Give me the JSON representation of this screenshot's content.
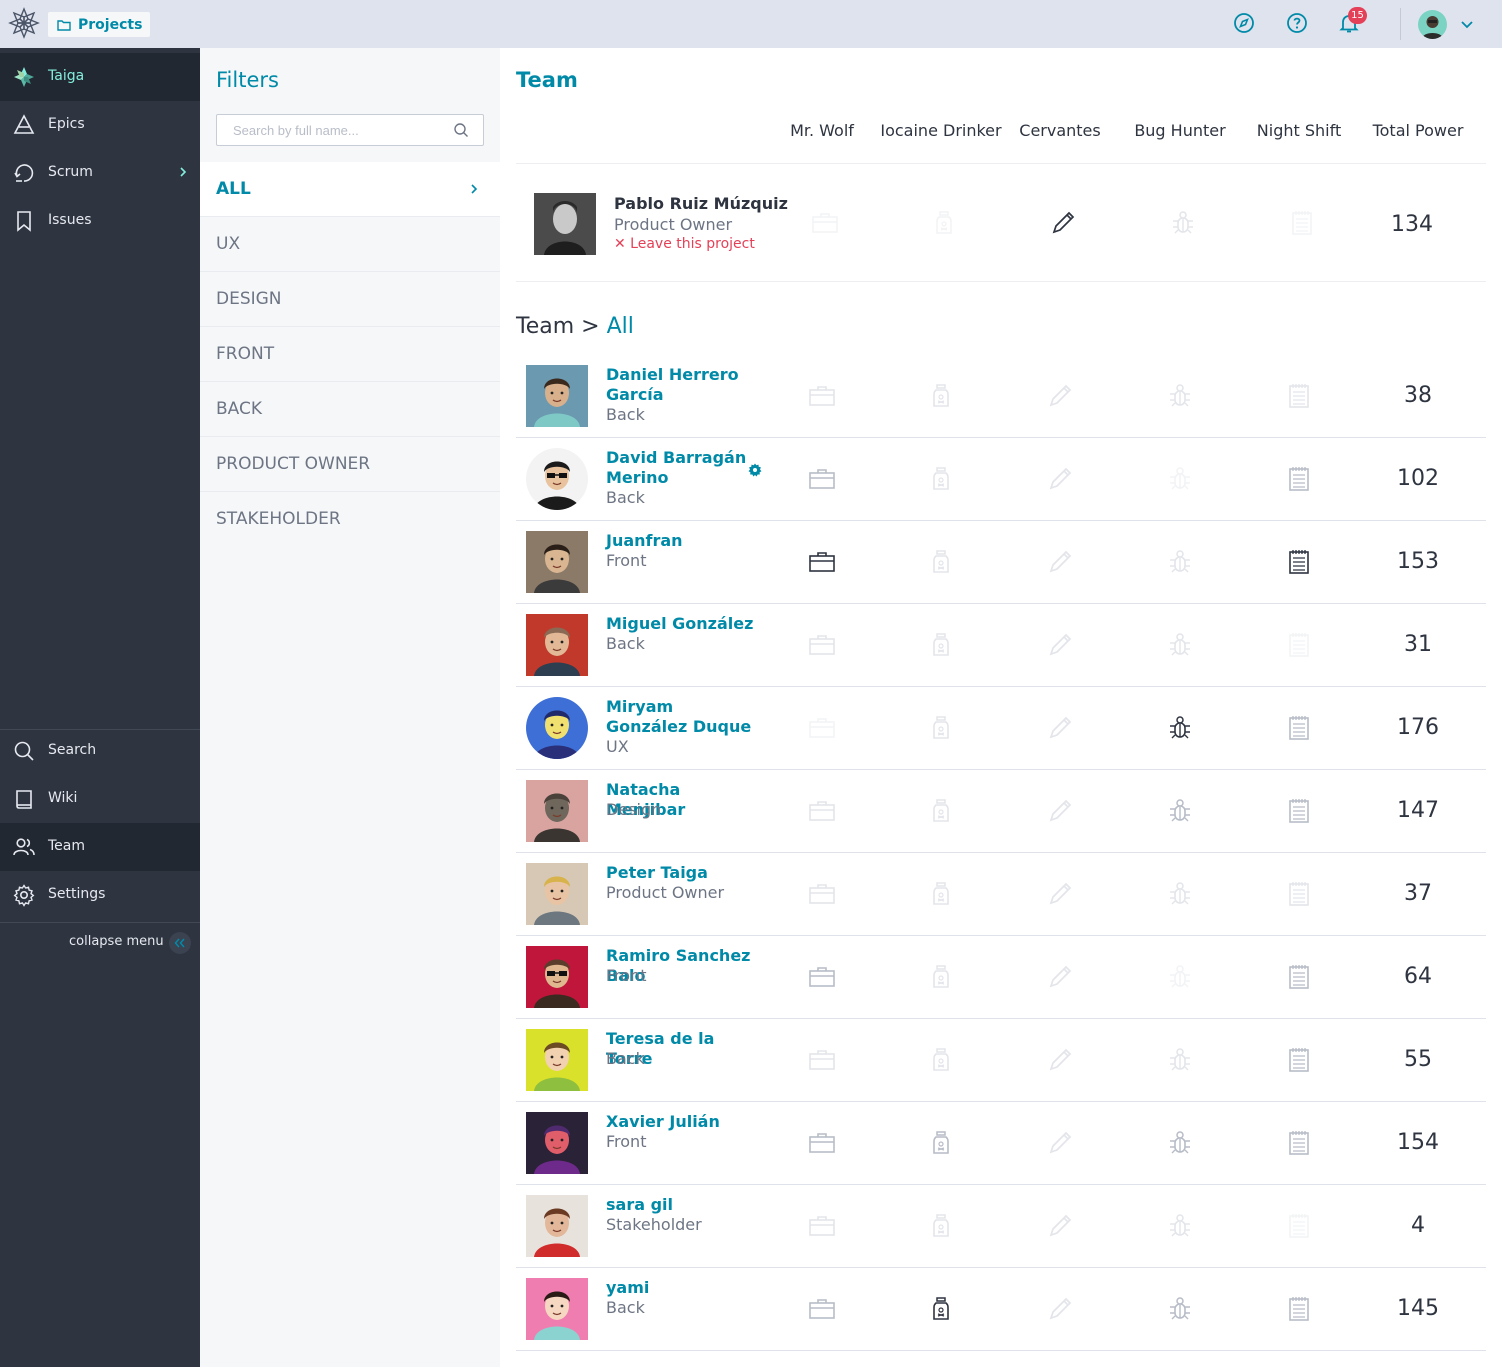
{
  "topbar": {
    "projects_label": "Projects",
    "notifications_count": "15"
  },
  "sidebar": {
    "items": [
      {
        "label": "Taiga",
        "icon": "taiga-logo-icon"
      },
      {
        "label": "Epics",
        "icon": "epics-icon"
      },
      {
        "label": "Scrum",
        "icon": "scrum-icon"
      },
      {
        "label": "Issues",
        "icon": "bookmark-icon"
      },
      {
        "label": "Search",
        "icon": "search-icon"
      },
      {
        "label": "Wiki",
        "icon": "book-icon"
      },
      {
        "label": "Team",
        "icon": "team-icon"
      },
      {
        "label": "Settings",
        "icon": "gear-icon"
      }
    ],
    "collapse_label": "collapse menu"
  },
  "filters": {
    "title": "Filters",
    "search_placeholder": "Search by full name...",
    "roles": [
      "ALL",
      "UX",
      "DESIGN",
      "FRONT",
      "BACK",
      "PRODUCT OWNER",
      "STAKEHOLDER"
    ],
    "active_role": "ALL"
  },
  "main": {
    "title": "Team",
    "columns": [
      "Mr. Wolf",
      "Iocaine Drinker",
      "Cervantes",
      "Bug Hunter",
      "Night Shift",
      "Total Power"
    ],
    "me": {
      "name": "Pablo Ruiz Múzquiz",
      "role": "Product Owner",
      "leave_label": "✕ Leave this project",
      "total": "134",
      "badges": [
        0,
        0,
        2,
        1,
        0
      ]
    },
    "breadcrumb_prefix": "Team > ",
    "breadcrumb_current": "All",
    "members": [
      {
        "name": "Daniel Herrero García",
        "role": "Back",
        "total": "38",
        "badges": [
          1,
          1,
          1,
          1,
          1
        ]
      },
      {
        "name": "David Barragán Merino",
        "role": "Back",
        "total": "102",
        "badges": [
          3,
          1,
          1,
          0,
          3
        ],
        "admin": true
      },
      {
        "name": "Juanfran",
        "role": "Front",
        "total": "153",
        "badges": [
          4,
          1,
          1,
          1,
          4
        ]
      },
      {
        "name": "Miguel González",
        "role": "Back",
        "total": "31",
        "badges": [
          1,
          1,
          1,
          1,
          0
        ]
      },
      {
        "name": "Miryam González Duque",
        "role": "UX",
        "total": "176",
        "badges": [
          0,
          1,
          1,
          4,
          3
        ]
      },
      {
        "name": "Natacha Menjibar",
        "role": "Design",
        "total": "147",
        "badges": [
          1,
          1,
          1,
          3,
          3
        ]
      },
      {
        "name": "Peter Taiga",
        "role": "Product Owner",
        "total": "37",
        "badges": [
          1,
          1,
          1,
          1,
          1
        ]
      },
      {
        "name": "Ramiro Sanchez Balo",
        "role": "Front",
        "total": "64",
        "badges": [
          3,
          1,
          1,
          0,
          3
        ]
      },
      {
        "name": "Teresa de la Torre",
        "role": "Back",
        "total": "55",
        "badges": [
          1,
          1,
          1,
          1,
          3
        ]
      },
      {
        "name": "Xavier Julián",
        "role": "Front",
        "total": "154",
        "badges": [
          3,
          3,
          1,
          3,
          3
        ]
      },
      {
        "name": "sara gil",
        "role": "Stakeholder",
        "total": "4",
        "badges": [
          1,
          1,
          1,
          1,
          0
        ]
      },
      {
        "name": "yami",
        "role": "Back",
        "total": "145",
        "badges": [
          3,
          4,
          1,
          3,
          3
        ]
      }
    ]
  },
  "colors": {
    "accent": "#008aa8",
    "sidebar_bg": "#2e3440",
    "sidebar_active": "#222831",
    "brand_text": "#83eede",
    "danger": "#e44057",
    "filters_bg": "#f6f7f9"
  }
}
